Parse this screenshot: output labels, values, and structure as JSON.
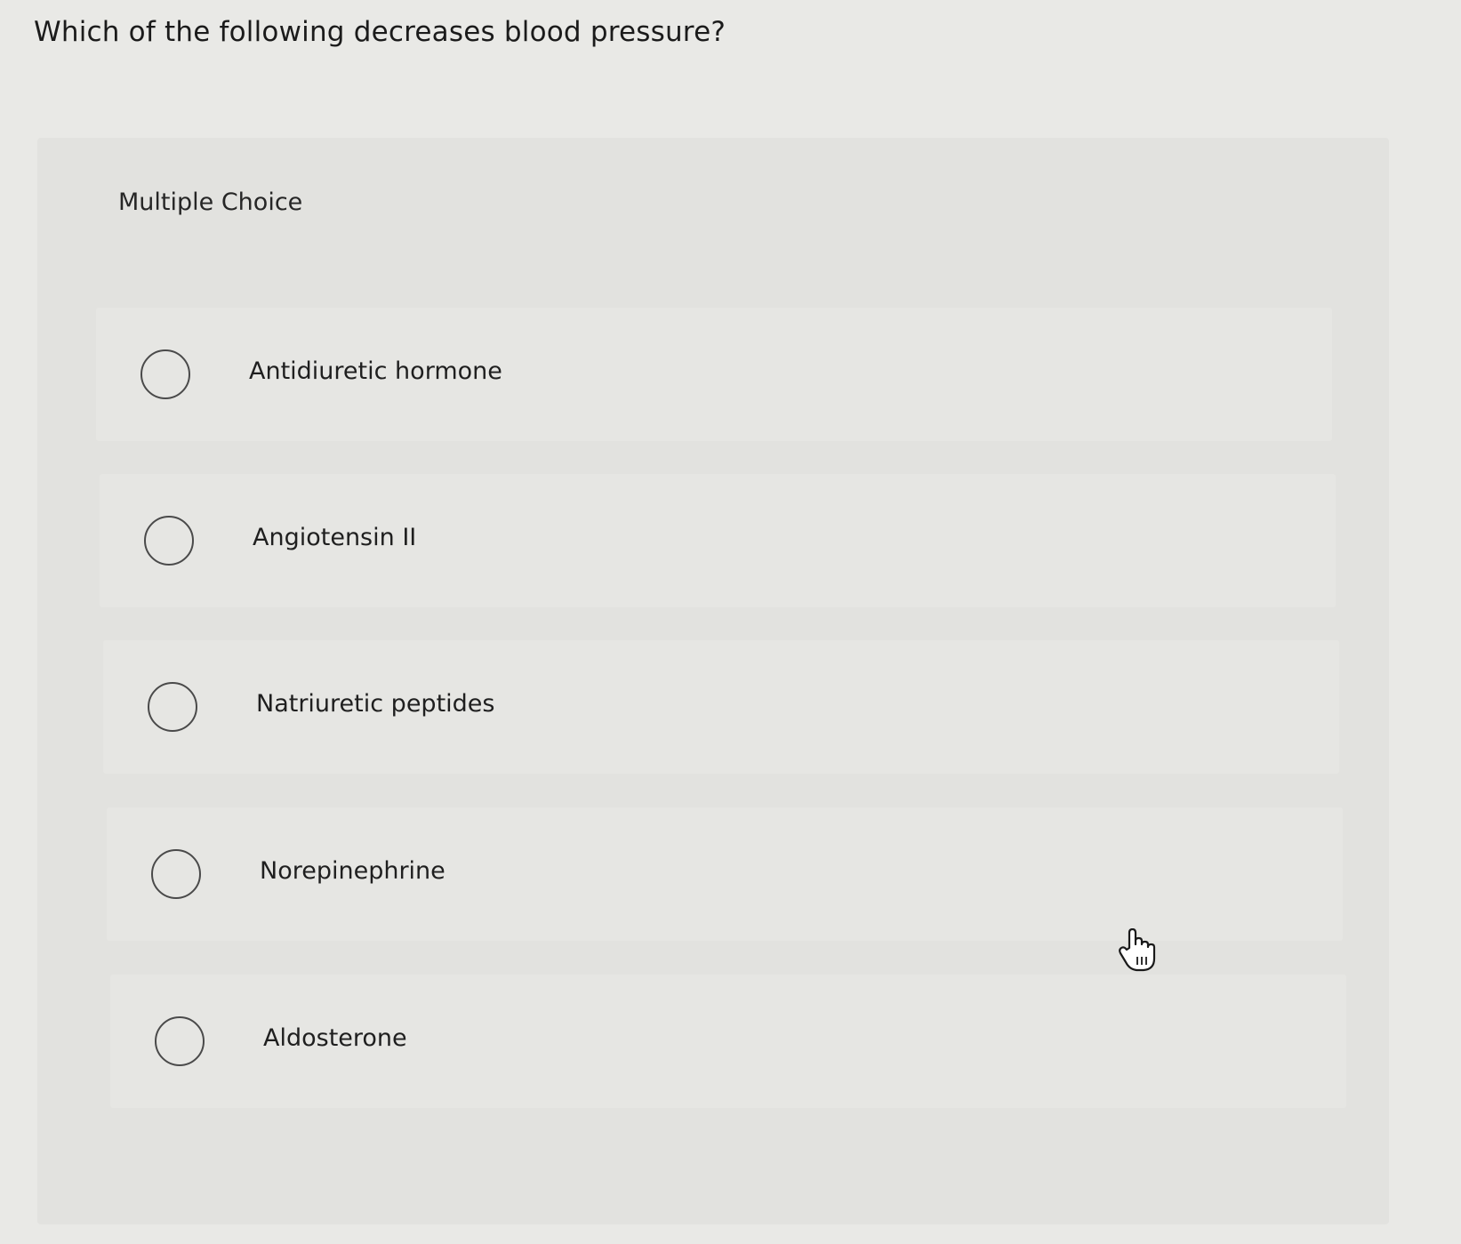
{
  "question": {
    "text": "Which of the following decreases blood pressure?"
  },
  "section": {
    "label": "Multiple Choice"
  },
  "options": [
    {
      "label": "Antidiuretic hormone",
      "selected": false
    },
    {
      "label": "Angiotensin II",
      "selected": false
    },
    {
      "label": "Natriuretic peptides",
      "selected": false
    },
    {
      "label": "Norepinephrine",
      "selected": false
    },
    {
      "label": "Aldosterone",
      "selected": false
    }
  ],
  "cursor": {
    "icon": "hand-pointer-icon"
  },
  "colors": {
    "background": "#e9e9e6",
    "panel": "#e2e2df",
    "text": "#1e1e1e",
    "radio_border": "#4a4a4a"
  }
}
